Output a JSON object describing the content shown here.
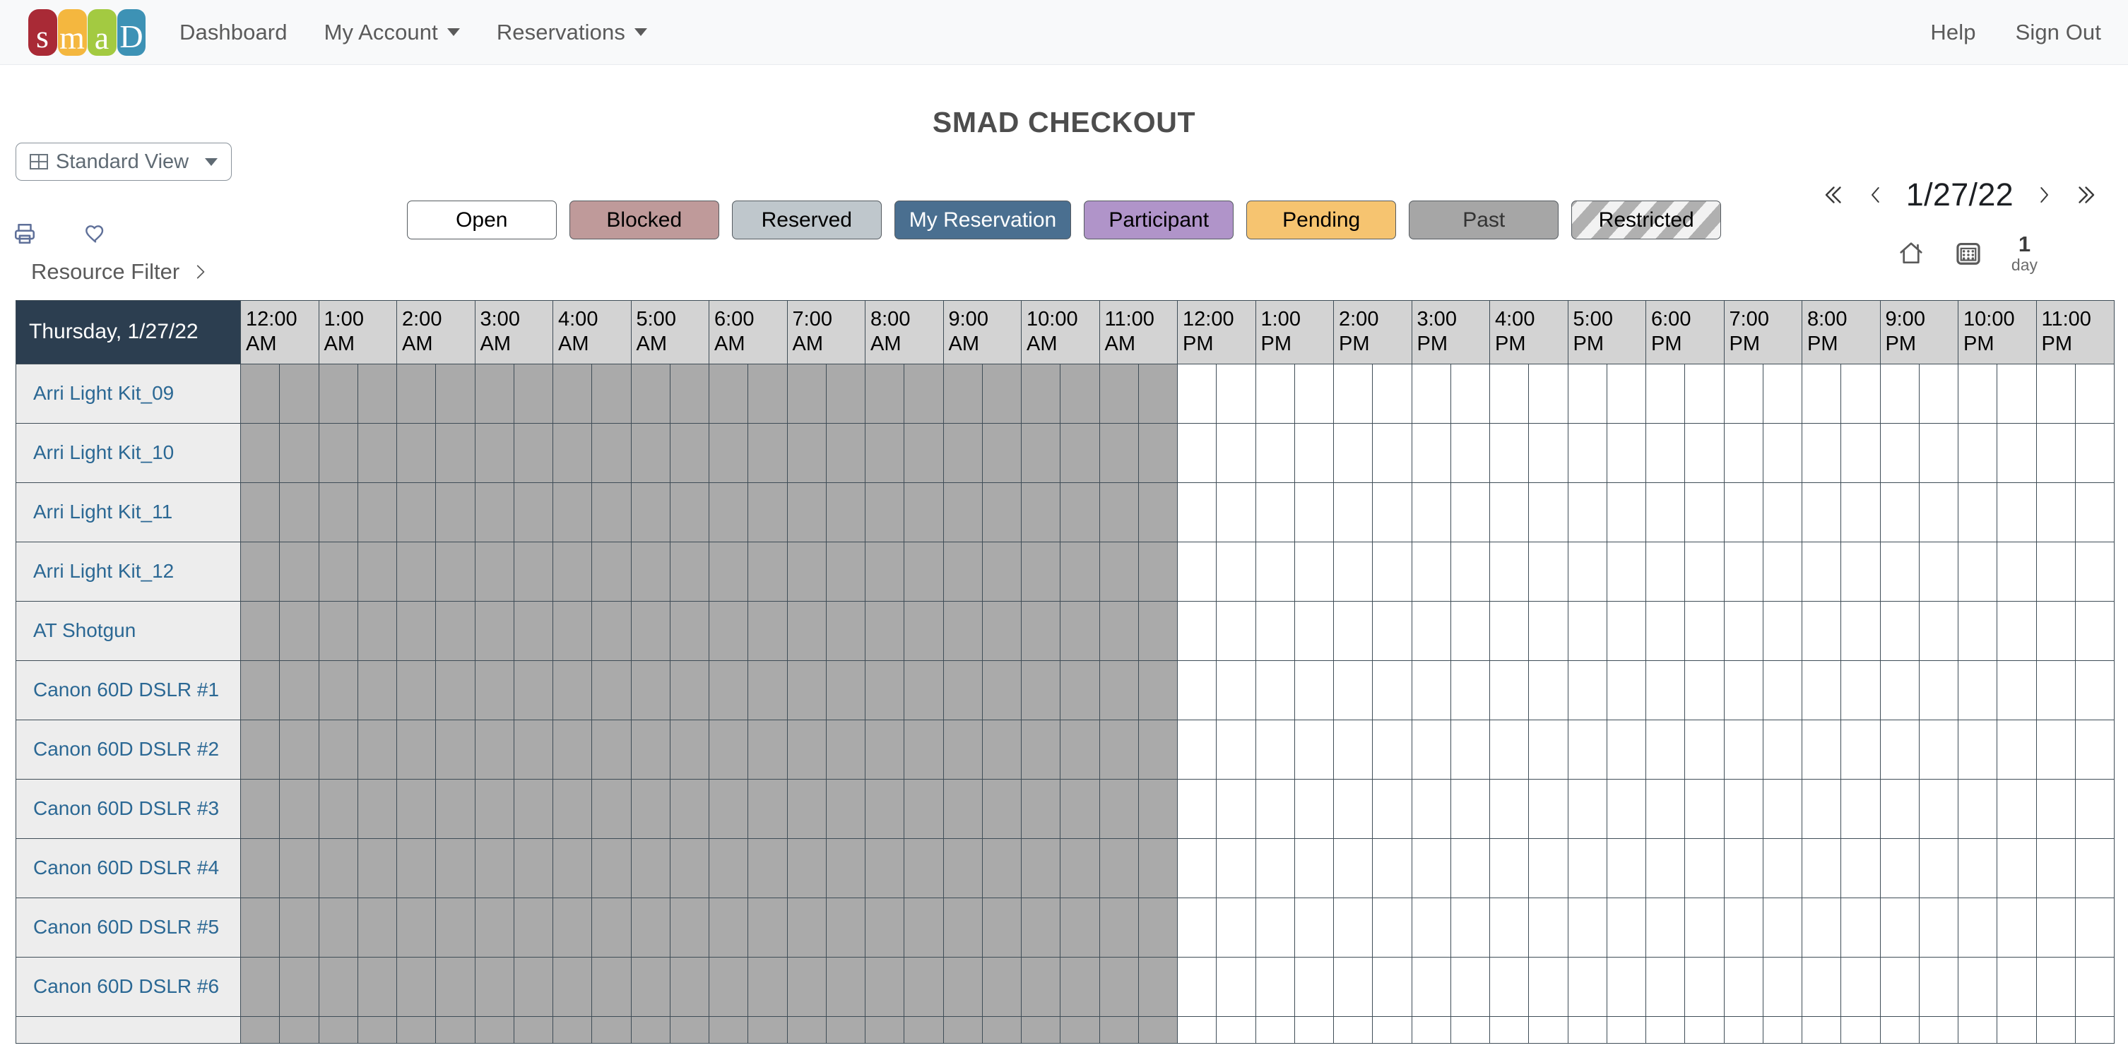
{
  "navbar": {
    "logo_alt": "smad",
    "logo_letters": [
      {
        "ch": "s",
        "color": "#a92a36"
      },
      {
        "ch": "m",
        "color": "#f4b73f"
      },
      {
        "ch": "a",
        "color": "#a3ca41"
      },
      {
        "ch": "D",
        "color": "#3d92b5"
      }
    ],
    "links": [
      {
        "label": "Dashboard",
        "caret": false
      },
      {
        "label": "My Account",
        "caret": true
      },
      {
        "label": "Reservations",
        "caret": true
      }
    ],
    "right_links": [
      {
        "label": "Help"
      },
      {
        "label": "Sign Out"
      }
    ]
  },
  "toolbar": {
    "view_label": "Standard View",
    "view_icon": "grid-icon",
    "print_icon": "printer-icon",
    "favorite_icon": "heart-icon"
  },
  "header": {
    "title": "SMAD CHECKOUT"
  },
  "date_nav": {
    "first_icon": "double-chevron-left-icon",
    "prev_icon": "chevron-left-icon",
    "date": "1/27/22",
    "next_icon": "chevron-right-icon",
    "last_icon": "double-chevron-right-icon",
    "home_icon": "home-icon",
    "calendar_icon": "calendar-icon",
    "span_number": "1",
    "span_unit": "day"
  },
  "legend": [
    {
      "label": "Open",
      "bg": "#ffffff",
      "fg": "#000000",
      "striped": false
    },
    {
      "label": "Blocked",
      "bg": "#bf9a9a",
      "fg": "#000000",
      "striped": false
    },
    {
      "label": "Reserved",
      "bg": "#bfc7cc",
      "fg": "#000000",
      "striped": false
    },
    {
      "label": "My Reservation",
      "bg": "#4a6f90",
      "fg": "#ffffff",
      "striped": false
    },
    {
      "label": "Participant",
      "bg": "#b094c9",
      "fg": "#000000",
      "striped": false
    },
    {
      "label": "Pending",
      "bg": "#f6c470",
      "fg": "#000000",
      "striped": false
    },
    {
      "label": "Past",
      "bg": "#a6a6a6",
      "fg": "#333333",
      "striped": false
    },
    {
      "label": "Restricted",
      "bg": "#b9b9b9",
      "fg": "#000000",
      "striped": true
    }
  ],
  "resource_filter": {
    "label": "Resource Filter",
    "chevron_icon": "chevron-right-icon"
  },
  "schedule": {
    "day_header": "Thursday, 1/27/22",
    "hours": [
      "12:00 AM",
      "1:00 AM",
      "2:00 AM",
      "3:00 AM",
      "4:00 AM",
      "5:00 AM",
      "6:00 AM",
      "7:00 AM",
      "8:00 AM",
      "9:00 AM",
      "10:00 AM",
      "11:00 AM",
      "12:00 PM",
      "1:00 PM",
      "2:00 PM",
      "3:00 PM",
      "4:00 PM",
      "5:00 PM",
      "6:00 PM",
      "7:00 PM",
      "8:00 PM",
      "9:00 PM",
      "10:00 PM",
      "11:00 PM"
    ],
    "slots_per_hour": 2,
    "past_slot_count": 24,
    "resources": [
      {
        "name": "Arri Light Kit_09"
      },
      {
        "name": "Arri Light Kit_10"
      },
      {
        "name": "Arri Light Kit_11"
      },
      {
        "name": "Arri Light Kit_12"
      },
      {
        "name": "AT Shotgun"
      },
      {
        "name": "Canon 60D DSLR #1"
      },
      {
        "name": "Canon 60D DSLR #2"
      },
      {
        "name": "Canon 60D DSLR #3"
      },
      {
        "name": "Canon 60D DSLR #4"
      },
      {
        "name": "Canon 60D DSLR #5"
      },
      {
        "name": "Canon 60D DSLR #6"
      },
      {
        "name": ""
      }
    ]
  }
}
